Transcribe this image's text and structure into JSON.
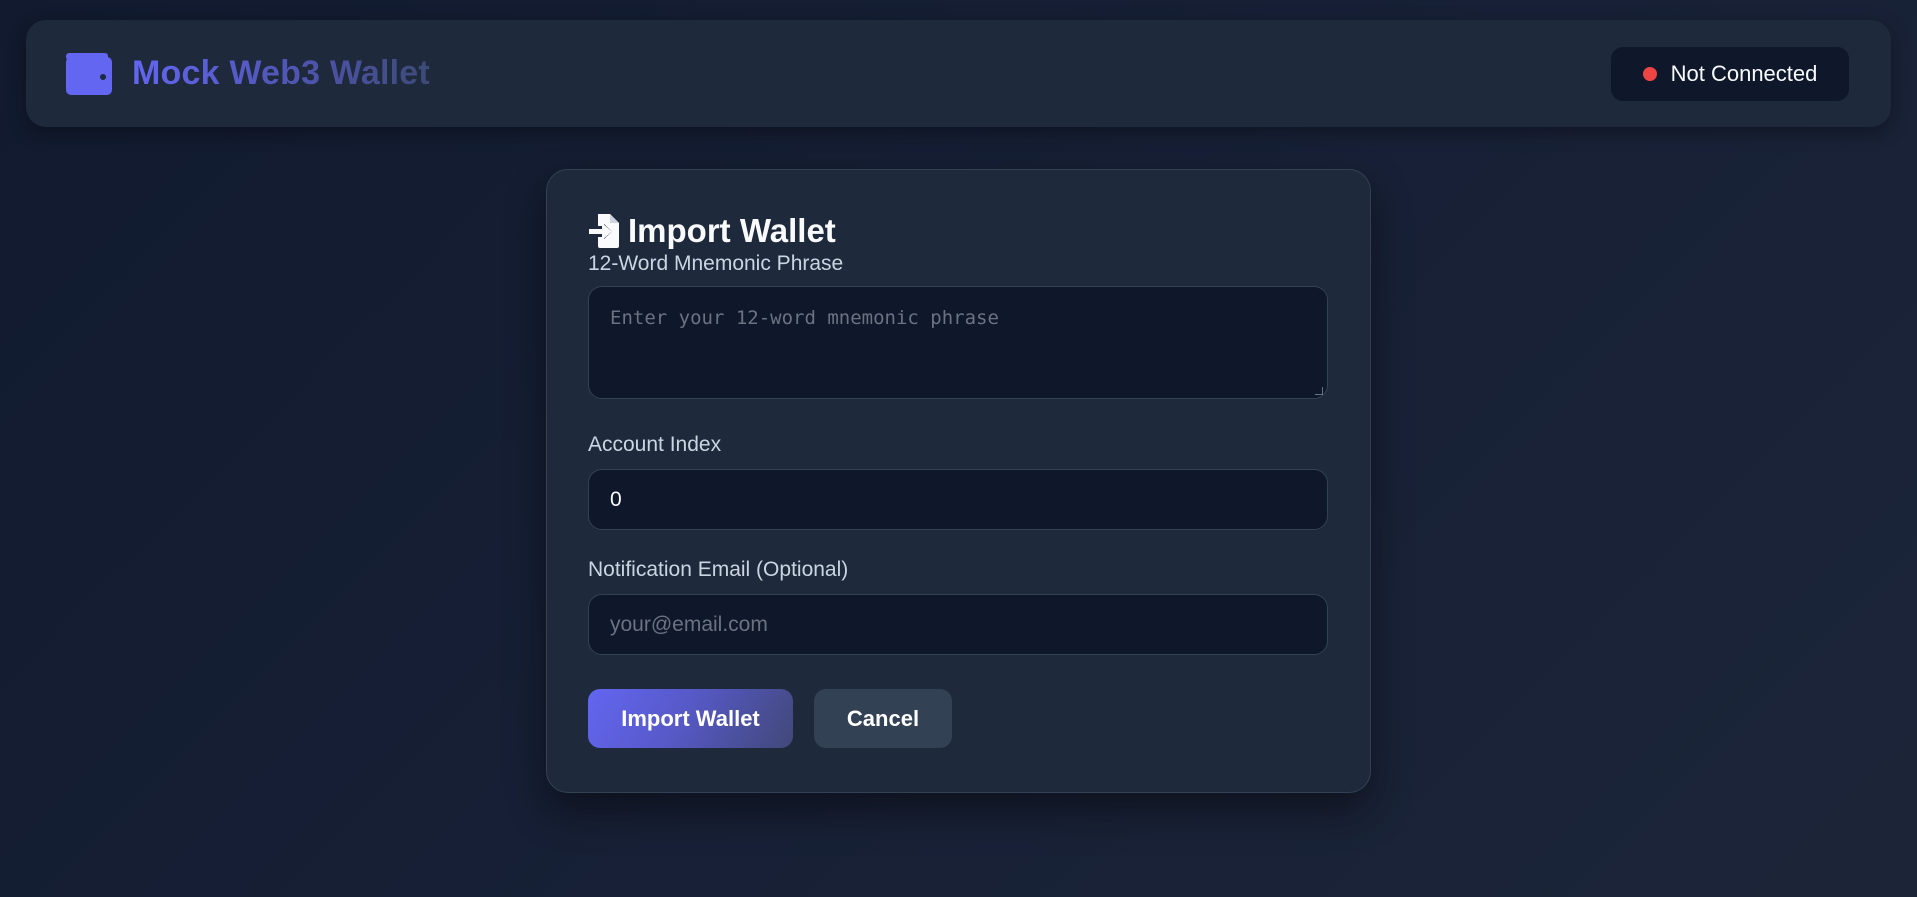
{
  "app": {
    "title": "Mock Web3 Wallet",
    "icon": "wallet-icon",
    "accent_color": "#6366f1"
  },
  "connection": {
    "status_text": "Not Connected",
    "status_color": "#ef4444"
  },
  "import_form": {
    "title": "Import Wallet",
    "title_icon": "file-import-icon",
    "mnemonic": {
      "label": "12-Word Mnemonic Phrase",
      "placeholder": "Enter your 12-word mnemonic phrase",
      "value": ""
    },
    "account_index": {
      "label": "Account Index",
      "value": "0"
    },
    "email": {
      "label": "Notification Email (Optional)",
      "placeholder": "your@email.com",
      "value": ""
    },
    "buttons": {
      "submit_label": "Import Wallet",
      "cancel_label": "Cancel"
    }
  }
}
